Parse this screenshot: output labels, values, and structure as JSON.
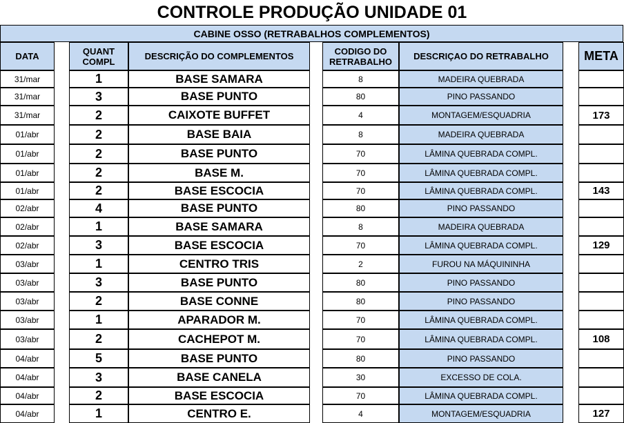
{
  "title": "CONTROLE PRODUÇÃO UNIDADE 01",
  "subtitle": "CABINE OSSO (RETRABALHOS COMPLEMENTOS)",
  "headers": {
    "date": "DATA",
    "qty": "QUANT COMPL",
    "desc": "DESCRIÇÃO DO COMPLEMENTOS",
    "code": "CODIGO DO RETRABALHO",
    "rework": "DESCRIÇAO DO RETRABALHO",
    "meta": "META"
  },
  "rows": [
    {
      "date": "31/mar",
      "qty": "1",
      "desc": "BASE SAMARA",
      "code": "8",
      "rework": "MADEIRA QUEBRADA",
      "meta": ""
    },
    {
      "date": "31/mar",
      "qty": "3",
      "desc": "BASE PUNTO",
      "code": "80",
      "rework": "PINO PASSANDO",
      "meta": ""
    },
    {
      "date": "31/mar",
      "qty": "2",
      "desc": "CAIXOTE BUFFET",
      "code": "4",
      "rework": "MONTAGEM/ESQUADRIA",
      "meta": "173"
    },
    {
      "date": "01/abr",
      "qty": "2",
      "desc": "BASE BAIA",
      "code": "8",
      "rework": "MADEIRA QUEBRADA",
      "meta": ""
    },
    {
      "date": "01/abr",
      "qty": "2",
      "desc": "BASE PUNTO",
      "code": "70",
      "rework": "LÂMINA QUEBRADA COMPL.",
      "meta": ""
    },
    {
      "date": "01/abr",
      "qty": "2",
      "desc": "BASE M.",
      "code": "70",
      "rework": "LÂMINA QUEBRADA COMPL.",
      "meta": ""
    },
    {
      "date": "01/abr",
      "qty": "2",
      "desc": "BASE ESCOCIA",
      "code": "70",
      "rework": "LÂMINA QUEBRADA COMPL.",
      "meta": "143"
    },
    {
      "date": "02/abr",
      "qty": "4",
      "desc": "BASE PUNTO",
      "code": "80",
      "rework": "PINO PASSANDO",
      "meta": ""
    },
    {
      "date": "02/abr",
      "qty": "1",
      "desc": "BASE SAMARA",
      "code": "8",
      "rework": "MADEIRA QUEBRADA",
      "meta": ""
    },
    {
      "date": "02/abr",
      "qty": "3",
      "desc": "BASE ESCOCIA",
      "code": "70",
      "rework": "LÂMINA QUEBRADA COMPL.",
      "meta": "129"
    },
    {
      "date": "03/abr",
      "qty": "1",
      "desc": "CENTRO TRIS",
      "code": "2",
      "rework": "FUROU NA MÁQUININHA",
      "meta": ""
    },
    {
      "date": "03/abr",
      "qty": "3",
      "desc": "BASE PUNTO",
      "code": "80",
      "rework": "PINO PASSANDO",
      "meta": ""
    },
    {
      "date": "03/abr",
      "qty": "2",
      "desc": "BASE CONNE",
      "code": "80",
      "rework": "PINO PASSANDO",
      "meta": ""
    },
    {
      "date": "03/abr",
      "qty": "1",
      "desc": "APARADOR M.",
      "code": "70",
      "rework": "LÂMINA QUEBRADA COMPL.",
      "meta": ""
    },
    {
      "date": "03/abr",
      "qty": "2",
      "desc": "CACHEPOT M.",
      "code": "70",
      "rework": "LÂMINA QUEBRADA COMPL.",
      "meta": "108"
    },
    {
      "date": "04/abr",
      "qty": "5",
      "desc": "BASE PUNTO",
      "code": "80",
      "rework": "PINO PASSANDO",
      "meta": ""
    },
    {
      "date": "04/abr",
      "qty": "3",
      "desc": "BASE CANELA",
      "code": "30",
      "rework": "EXCESSO DE COLA.",
      "meta": ""
    },
    {
      "date": "04/abr",
      "qty": "2",
      "desc": "BASE ESCOCIA",
      "code": "70",
      "rework": "LÂMINA QUEBRADA COMPL.",
      "meta": ""
    },
    {
      "date": "04/abr",
      "qty": "1",
      "desc": "CENTRO E.",
      "code": "4",
      "rework": "MONTAGEM/ESQUADRIA",
      "meta": "127"
    }
  ],
  "colors": {
    "header_fill": "#c5d9f1",
    "border": "#000000"
  }
}
